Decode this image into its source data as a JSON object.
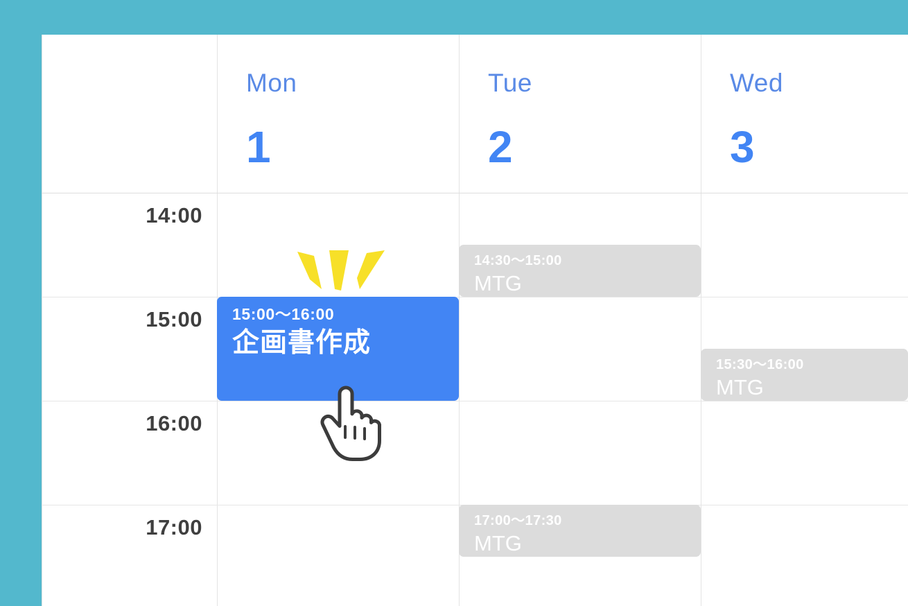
{
  "theme": {
    "background_teal": "#53b8cd",
    "panel_background": "#ffffff",
    "grid_line": "#e3e3e3",
    "day_name_blue": "#5a8ae6",
    "day_number_blue": "#4285f4",
    "time_label_gray": "#3f3f3f",
    "event_gray": "#dcdcdc",
    "event_blue": "#4285f4",
    "event_text_white": "#ffffff",
    "burst_yellow": "#f7e028",
    "cursor_outline": "#3c3c3c",
    "cursor_fill": "#ffffff"
  },
  "calendar": {
    "days": [
      {
        "name": "Mon",
        "number": "1"
      },
      {
        "name": "Tue",
        "number": "2"
      },
      {
        "name": "Wed",
        "number": "3"
      }
    ],
    "time_slots": [
      {
        "label": "14:00"
      },
      {
        "label": "15:00"
      },
      {
        "label": "16:00"
      },
      {
        "label": "17:00"
      }
    ],
    "events": [
      {
        "id": "tue-1430",
        "day": "Tue",
        "time": "14:30〜15:00",
        "title": "MTG",
        "style": "gray",
        "selected": false
      },
      {
        "id": "mon-1500",
        "day": "Mon",
        "time": "15:00〜16:00",
        "title": "企画書作成",
        "style": "blue",
        "selected": true
      },
      {
        "id": "wed-1530",
        "day": "Wed",
        "time": "15:30〜16:00",
        "title": "MTG",
        "style": "gray",
        "selected": false
      },
      {
        "id": "tue-1700",
        "day": "Tue",
        "time": "17:00〜17:30",
        "title": "MTG",
        "style": "gray",
        "selected": false
      }
    ]
  },
  "overlay": {
    "cursor_icon": "pointing-hand-cursor",
    "burst_icon": "click-burst-rays",
    "burst_ray_count": 3
  }
}
